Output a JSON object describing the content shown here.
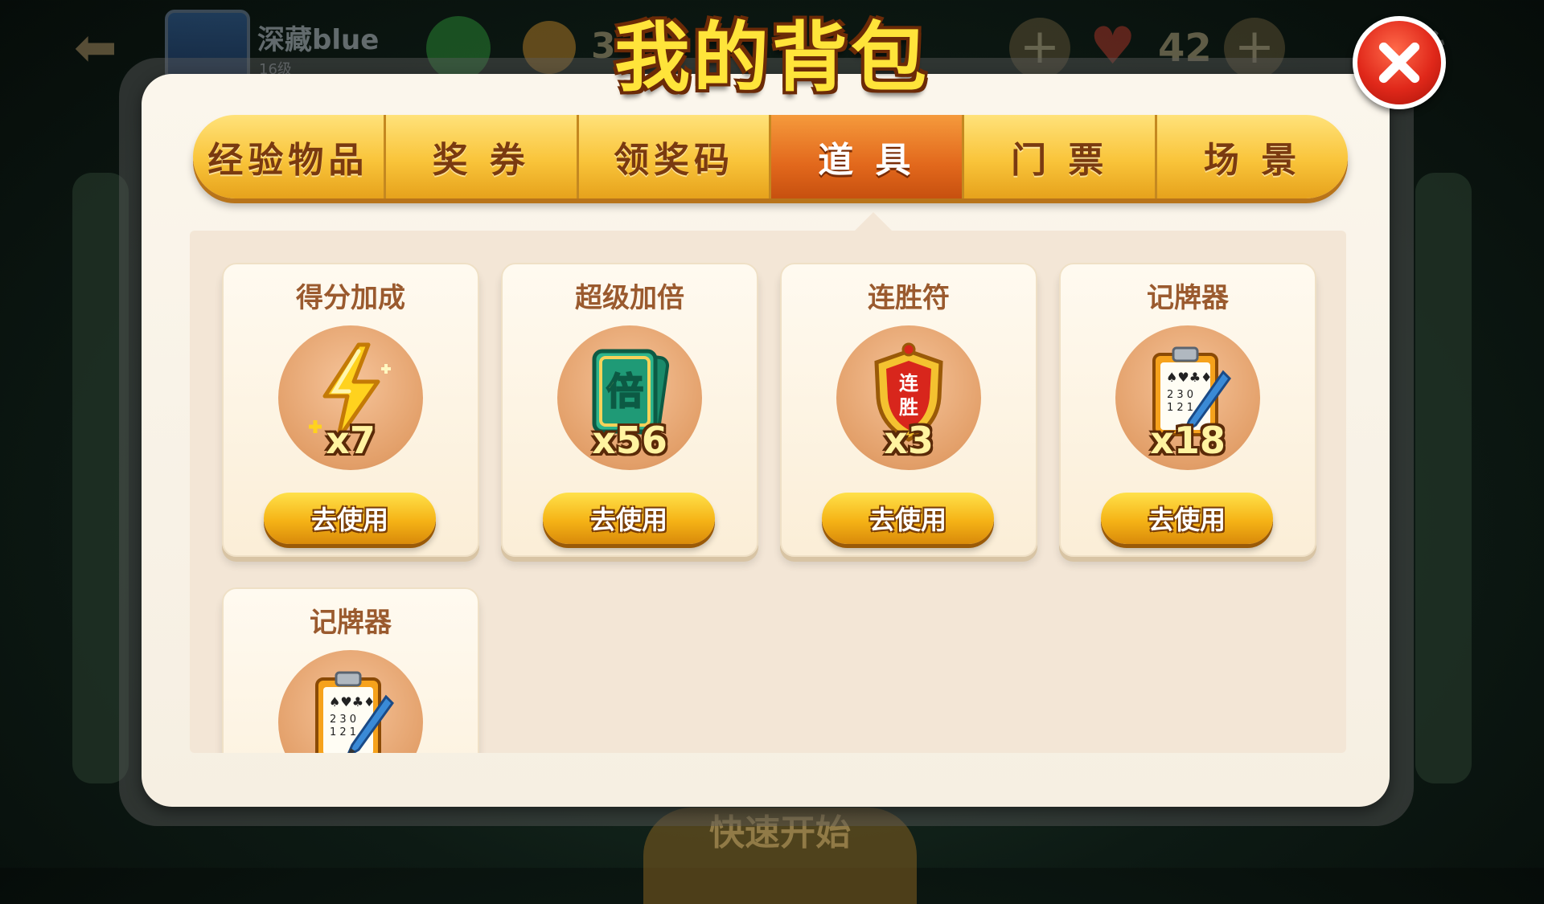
{
  "background": {
    "player_name": "深藏blue",
    "player_level": "16级",
    "coin_value": "3",
    "hearts_value": "42",
    "start_label": "快速开始"
  },
  "modal": {
    "title": "我的背包",
    "active_tab": "道具",
    "tabs": [
      {
        "label": "经验物品"
      },
      {
        "label": "奖 券"
      },
      {
        "label": "领奖码"
      },
      {
        "label": "道 具"
      },
      {
        "label": "门 票"
      },
      {
        "label": "场 景"
      }
    ],
    "items": [
      {
        "title": "得分加成",
        "count": "x7",
        "button": "去使用",
        "icon": "lightning-icon"
      },
      {
        "title": "超级加倍",
        "count": "x56",
        "button": "去使用",
        "icon": "double-card-icon"
      },
      {
        "title": "连胜符",
        "count": "x3",
        "button": "去使用",
        "icon": "win-streak-shield-icon",
        "icon_text": "连胜"
      },
      {
        "title": "记牌器",
        "count": "x18",
        "button": "去使用",
        "icon": "card-counter-icon"
      },
      {
        "title": "记牌器",
        "count": "",
        "button": "",
        "icon": "card-counter-icon"
      }
    ],
    "icon_text_double": "倍"
  },
  "colors": {
    "accent_yellow": "#f9c43a",
    "active_tab": "#e2681c",
    "close_red": "#e0281a",
    "title_yellow": "#ffe43a"
  }
}
